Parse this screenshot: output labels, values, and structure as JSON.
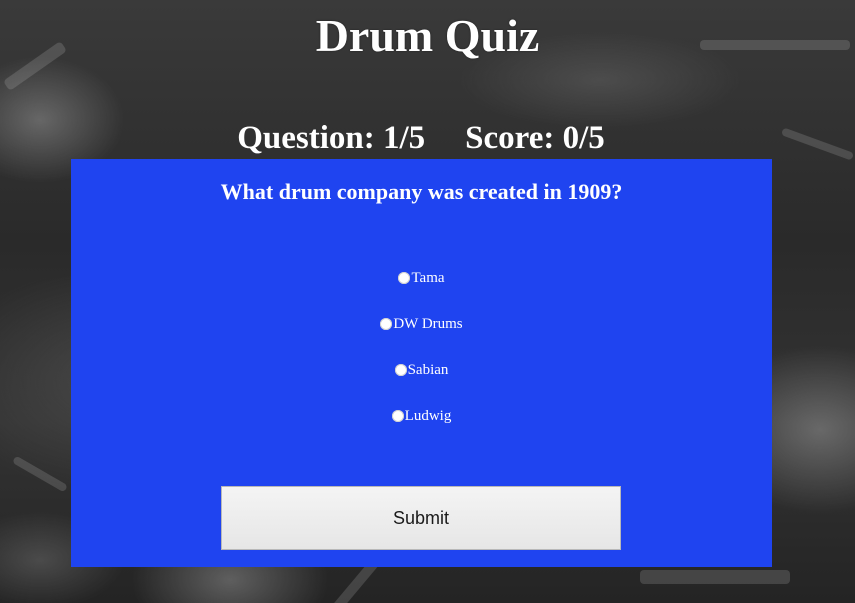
{
  "header": {
    "title": "Drum Quiz"
  },
  "status": {
    "question_text": "Question: 1/5",
    "score_text": "Score: 0/5"
  },
  "quiz": {
    "question": "What drum company was created in 1909?",
    "options": [
      {
        "label": "Tama",
        "selected": false
      },
      {
        "label": "DW Drums",
        "selected": false
      },
      {
        "label": "Sabian",
        "selected": false
      },
      {
        "label": "Ludwig",
        "selected": false
      }
    ],
    "submit_label": "Submit"
  },
  "colors": {
    "card_background": "#1f44f0",
    "text": "#ffffff",
    "button_background": "#ececec",
    "button_text": "#1a1a1a"
  },
  "background": {
    "description": "grayscale photo of a drum kit"
  }
}
